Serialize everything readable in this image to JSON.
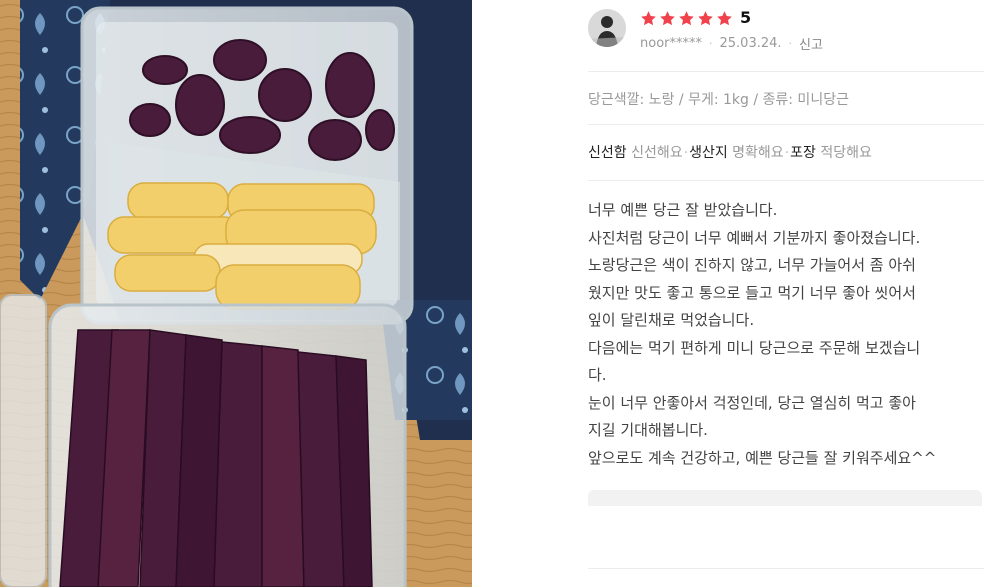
{
  "photo": {
    "alt_icon": "food-photo-icon",
    "colors": {
      "purple": "#4a1c3c",
      "yellow": "#f3cf6c",
      "blue": "#233a5e",
      "wood": "#c99a5c"
    }
  },
  "review": {
    "rating": "5",
    "rating_value": 5,
    "rating_max": 5,
    "star_color": "#f0414c",
    "username": "noor*****",
    "date": "25.03.24.",
    "report_label": "신고",
    "options": "당근색깔: 노랑 / 무게: 1kg / 종류: 미니당근",
    "attributes": [
      {
        "key": "신선함",
        "value": "신선해요"
      },
      {
        "key": "생산지",
        "value": "명확해요"
      },
      {
        "key": "포장",
        "value": "적당해요"
      }
    ],
    "body_lines": [
      "너무 예쁜 당근 잘 받았습니다.",
      "사진처럼 당근이 너무 예뻐서 기분까지 좋아졌습니다.",
      "노랑당근은 색이 진하지 않고, 너무 가늘어서 좀 아쉬",
      "웠지만 맛도 좋고 통으로 들고 먹기 너무 좋아 씻어서",
      "잎이 달린채로 먹었습니다.",
      "다음에는 먹기 편하게 미니 당근으로 주문해 보겠습니",
      "다.",
      "눈이 너무 안좋아서 걱정인데, 당근 열심히 먹고 좋아",
      "지길 기대해봅니다.",
      "앞으로도 계속 건강하고, 예쁜 당근들 잘 키워주세요^^"
    ]
  }
}
